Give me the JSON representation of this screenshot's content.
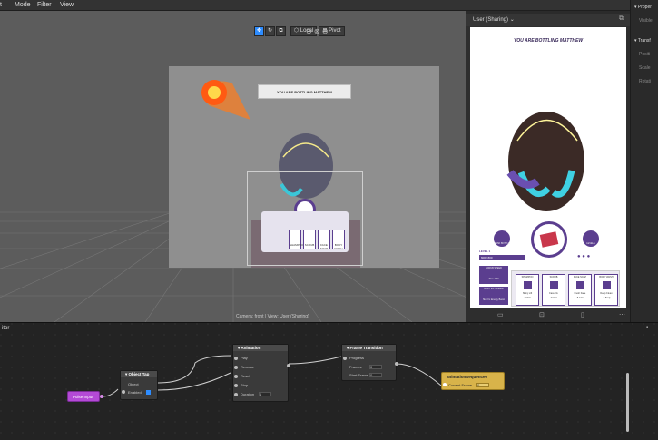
{
  "menubar": {
    "items": [
      "Mode",
      "Filter",
      "View"
    ],
    "partial_left": "t"
  },
  "viewport": {
    "toolbar": {
      "local_label": "Local",
      "pivot_label": "Pivot"
    },
    "stage_banner": "YOU ARE BOTTLING MATTHEW",
    "stage_icon_labels": [
      "SHAMPOO",
      "SCRUB",
      "FACE SOAP",
      "BODY WASH"
    ],
    "caption": "Camera: front | View: User (Sharing)"
  },
  "preview": {
    "title": "User (Sharing)",
    "banner": "YOU ARE BOTTLING MATTHEW",
    "left_button": "MASK BOTTLE",
    "right_button": "LEVELS",
    "level_label": "LEVEL 1",
    "level_value": "600 / 800",
    "cards": [
      {
        "title": "SHAMPOO",
        "line1": "Shiny Lift",
        "line2": "+5 Hair"
      },
      {
        "title": "SCRUB",
        "line1": "Face Fix",
        "line2": "+5 Skin"
      },
      {
        "title": "FACE SOAP",
        "line1": "Fresh Face",
        "line2": "+5 Glow"
      },
      {
        "title": "BODY WASH",
        "line1": "Deep Clean",
        "line2": "+5 Body"
      }
    ],
    "left_cards": [
      {
        "title": "SCRUB SPEED",
        "text": "Time 2:00"
      },
      {
        "title": "BODY EXTENDER",
        "text": "Skin Fx Energy Boost"
      }
    ]
  },
  "right_panel": {
    "header1": "Proper",
    "item1": "Visible",
    "header2": "Transf",
    "items": [
      "Positi",
      "Scale",
      "Rotati"
    ]
  },
  "patch_editor": {
    "title": "itor",
    "pulse_node": "Pulse Input",
    "object_tap": {
      "title": "Object Tap",
      "ports": [
        "Object",
        "Enabled"
      ]
    },
    "animation": {
      "title": "Animation",
      "ports": [
        "Play",
        "Reverse",
        "Reset",
        "Stop",
        "Duration"
      ],
      "duration_value": "1"
    },
    "frame_transition": {
      "title": "Frame Transition",
      "ports": [
        "Progress",
        "Frames",
        "Start Frame"
      ],
      "frames_value": "0",
      "start_value": "0"
    },
    "output": {
      "title": "animationSequence0",
      "port": "Current Frame",
      "value": "0"
    }
  },
  "colors": {
    "accent": "#2d8cff",
    "purple": "#5b3e8f",
    "pulse": "#b44ad6",
    "output": "#d8b34a"
  }
}
